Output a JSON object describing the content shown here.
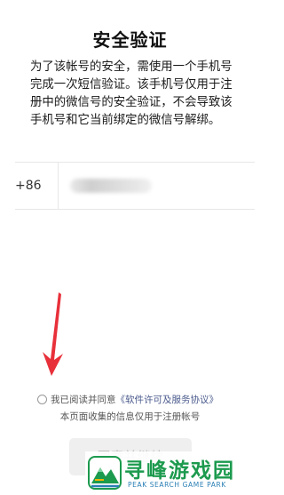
{
  "header": {
    "title": "安全验证"
  },
  "description": {
    "text": "为了该帐号的安全，需使用一个手机号完成一次短信验证。该手机号仅用于注册中的微信号的安全验证，不会导致该手机号和它当前绑定的微信号解绑。"
  },
  "phone": {
    "country_code": "+86"
  },
  "agreement": {
    "prefix": "我已阅读并同意",
    "link_text": "《软件许可及服务协议》",
    "checked": false
  },
  "note": {
    "text": "本页面收集的信息仅用于注册帐号"
  },
  "next_button": {
    "label": "同意并继续"
  },
  "watermark": {
    "title": "寻峰游戏园",
    "subtitle": "PEAK SEARCH GAME PARK"
  },
  "colors": {
    "arrow": "#e8303a",
    "link": "#4a5a8c",
    "watermark_green": "#1c9a4e",
    "watermark_blue": "#2a7fb5"
  },
  "icons": {
    "arrow": "red-arrow-down-icon",
    "radio": "radio-unchecked-icon",
    "logo": "mountain-logo-icon"
  }
}
